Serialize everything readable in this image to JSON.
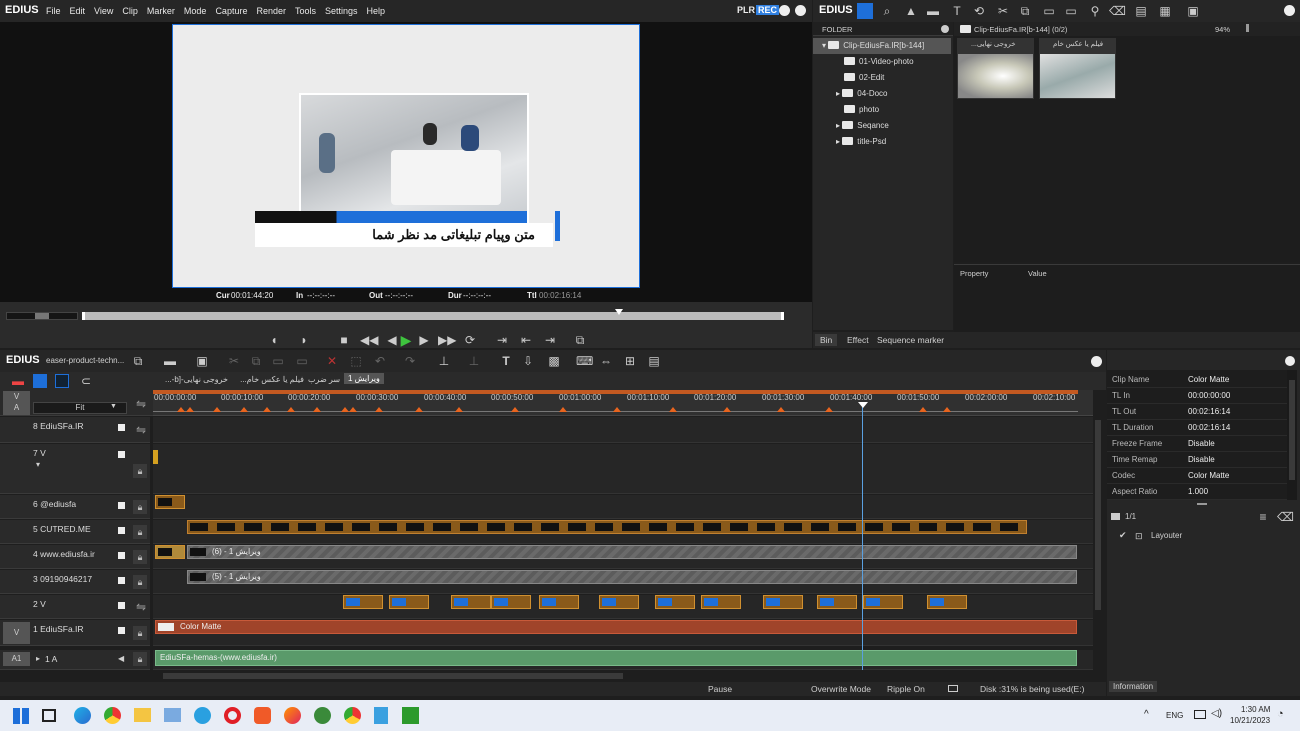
{
  "app": {
    "name": "EDIUS",
    "menu": [
      "File",
      "Edit",
      "View",
      "Clip",
      "Marker",
      "Mode",
      "Capture",
      "Render",
      "Tools",
      "Settings",
      "Help"
    ],
    "plr": "PLR",
    "rec": "REC"
  },
  "preview": {
    "overlay_text": "متن وپیام تبلیغاتی مد نظر شما",
    "timecodes": {
      "cur_label": "Cur",
      "cur": "00:01:44:20",
      "in_label": "In",
      "in": "--:--:--:--",
      "out_label": "Out",
      "out": "--:--:--:--",
      "dur_label": "Dur",
      "dur": "--:--:--:--",
      "ttl_label": "Ttl",
      "ttl": "00:02:16:14"
    }
  },
  "bin": {
    "app_name": "EDIUS",
    "folder_header": "FOLDER",
    "path": "Clip-EdiusFa.IR[b-144] (0/2)",
    "zoom": "94%",
    "tree": [
      {
        "label": "Clip-EdiusFa.IR[b-144]",
        "selected": true
      },
      {
        "label": "01-Video-photo"
      },
      {
        "label": "02-Edit"
      },
      {
        "label": "04-Doco"
      },
      {
        "label": "photo"
      },
      {
        "label": "Seqance"
      },
      {
        "label": "title-Psd"
      }
    ],
    "clips": [
      {
        "label": "خروجی نهایی..."
      },
      {
        "label": "فیلم یا عکس خام"
      }
    ],
    "property_col": "Property",
    "value_col": "Value",
    "tabs": [
      "Bin",
      "Effect",
      "Sequence marker"
    ]
  },
  "timeline": {
    "app_name": "EDIUS",
    "project": "easer-product-techn...",
    "seq_tabs": [
      "خروجی نهایی-[b-...",
      "فیلم یا عکس خام...",
      "سر ضرب",
      "ویرایش 1"
    ],
    "zoom_label": "Fit",
    "ruler": [
      "00:00:00:00",
      "00:00:10:00",
      "00:00:20:00",
      "00:00:30:00",
      "00:00:40:00",
      "00:00:50:00",
      "00:01:00:00",
      "00:01:10:00",
      "00:01:20:00",
      "00:01:30:00",
      "00:01:40:00",
      "00:01:50:00",
      "00:02:00:00",
      "00:02:10:00"
    ],
    "tracks": [
      "8 EdiuSFa.IR",
      "7 V",
      "6 @ediusfa",
      "5 CUTRED.ME",
      "4 www.ediusfa.ir",
      "3 09190946217",
      "2 V",
      "1 EdiuSFa.IR",
      "1 A"
    ],
    "track_side_labels": {
      "va_v": "V",
      "va_a": "A",
      "v1": "V",
      "a1": "A1"
    },
    "clip_labels": {
      "t4": "ویرایش 1 - (6)",
      "t3": "ویرایش 1 - (5)",
      "t1": "Color Matte",
      "a1": "EdiuSFa-hemas-(www.ediusfa.ir)"
    },
    "status": {
      "state": "Pause",
      "mode": "Overwrite Mode",
      "ripple": "Ripple On",
      "disk": "Disk :31% is being used(E:)"
    }
  },
  "info": {
    "rows": [
      [
        "Clip Name",
        "Color Matte"
      ],
      [
        "TL In",
        "00:00:00:00"
      ],
      [
        "TL Out",
        "00:02:16:14"
      ],
      [
        "TL Duration",
        "00:02:16:14"
      ],
      [
        "Freeze Frame",
        "Disable"
      ],
      [
        "Time Remap",
        "Disable"
      ],
      [
        "Codec",
        "Color Matte"
      ],
      [
        "Aspect Ratio",
        "1.000"
      ]
    ],
    "page": "1/1",
    "layer": "Layouter",
    "tab": "Information"
  },
  "taskbar": {
    "lang": "ENG",
    "time": "1:30 AM",
    "date": "10/21/2023"
  },
  "colors": {
    "accent": "#1e6fd9",
    "marker": "#e8641e",
    "play": "#3ec43e",
    "rec": "#2f7fe0"
  }
}
